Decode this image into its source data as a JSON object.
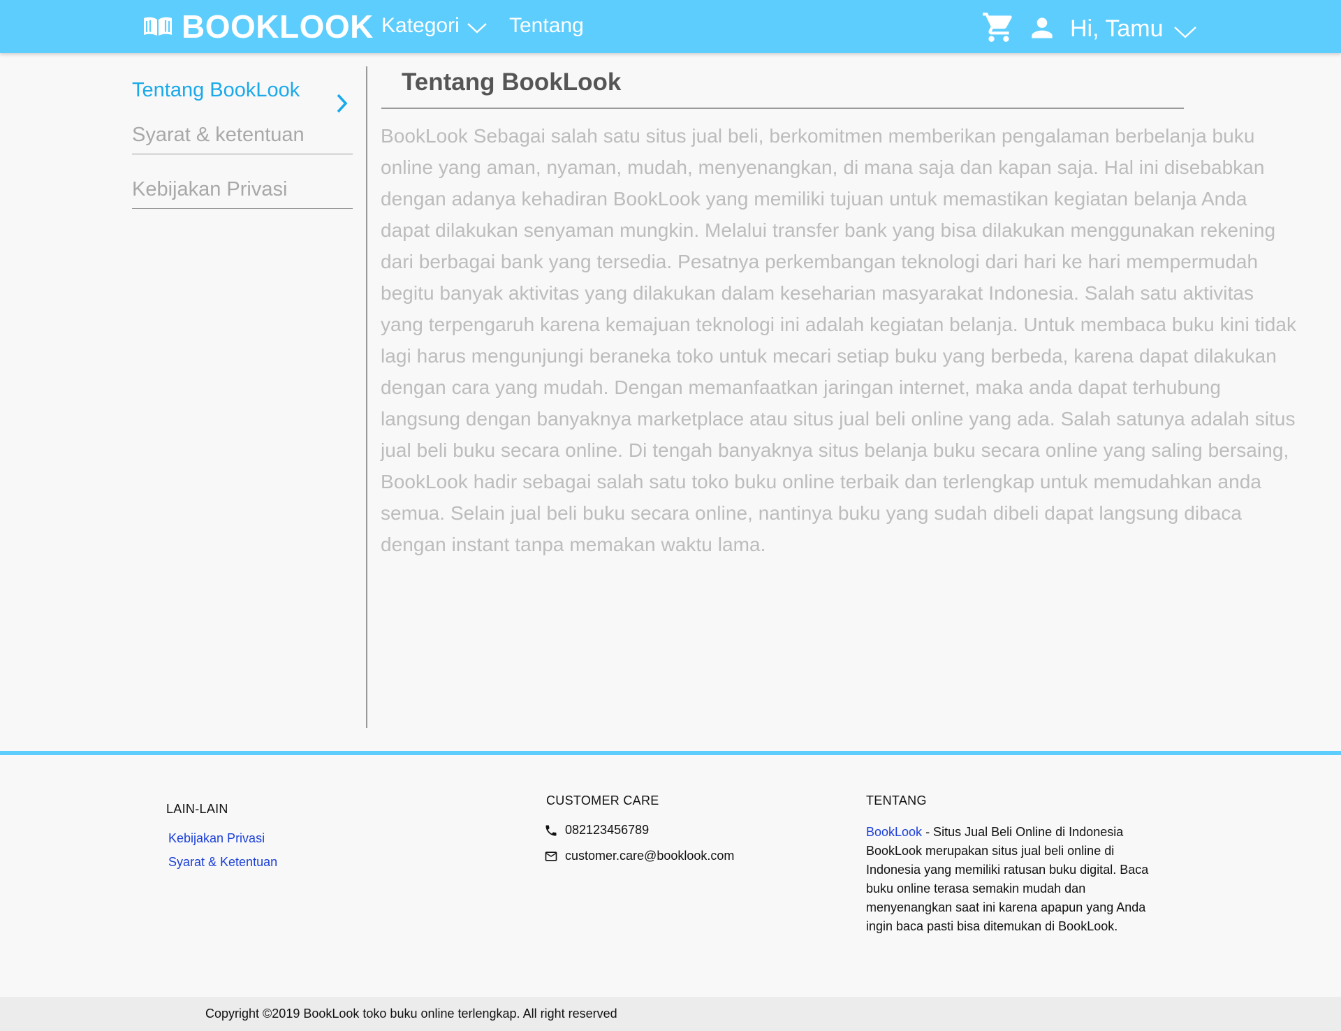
{
  "header": {
    "brand": "BOOKLOOK",
    "brand_icon": "open-book-icon",
    "nav": {
      "kategori": "Kategori",
      "tentang": "Tentang"
    },
    "cart_icon": "cart-icon",
    "user_icon": "user-icon",
    "greeting": "Hi, Tamu",
    "colors": {
      "bar": "#5ccdfd",
      "text": "#ffffff"
    }
  },
  "sidebar": {
    "items": [
      {
        "label": "Tentang BookLook",
        "active": true
      },
      {
        "label": "Syarat & ketentuan",
        "active": false
      },
      {
        "label": "Kebijakan Privasi",
        "active": false
      }
    ],
    "active_color": "#1ba9ea"
  },
  "main": {
    "title": "Tentang BookLook",
    "body": "BookLook Sebagai salah satu situs jual beli, berkomitmen memberikan pengalaman berbelanja buku online yang aman, nyaman, mudah, menyenangkan, di mana saja dan kapan saja. Hal ini disebabkan dengan adanya kehadiran BookLook yang memiliki tujuan untuk memastikan kegiatan belanja Anda dapat dilakukan senyaman mungkin. Melalui transfer bank yang bisa dilakukan menggunakan rekening dari berbagai bank yang tersedia. Pesatnya perkembangan teknologi dari hari ke hari mempermudah begitu banyak aktivitas yang dilakukan dalam keseharian masyarakat Indonesia. Salah satu aktivitas yang terpengaruh karena kemajuan teknologi ini adalah kegiatan belanja. Untuk membaca buku kini tidak lagi harus mengunjungi beraneka toko untuk mecari setiap buku yang berbeda, karena dapat dilakukan dengan cara yang mudah. Dengan memanfaatkan jaringan  internet, maka anda dapat terhubung langsung dengan banyaknya marketplace atau situs jual beli online yang ada. Salah satunya adalah situs jual beli buku secara online. Di tengah banyaknya situs belanja buku secara online yang saling bersaing, BookLook hadir sebagai salah satu toko buku online terbaik dan terlengkap untuk memudahkan anda semua. Selain jual beli buku secara online, nantinya buku yang sudah dibeli dapat langsung dibaca dengan instant tanpa memakan waktu lama."
  },
  "footer": {
    "lain_lain": {
      "heading": "LAIN-LAIN",
      "links": [
        "Kebijakan Privasi",
        "Syarat & Ketentuan"
      ]
    },
    "customer_care": {
      "heading": "CUSTOMER CARE",
      "phone": "082123456789",
      "phone_icon": "phone-icon",
      "email": "customer.care@booklook.com",
      "email_icon": "mail-icon"
    },
    "tentang": {
      "heading": "TENTANG",
      "brand_link": "BookLook",
      "tagline": " - Situs Jual Beli Online di Indonesia",
      "description": "BookLook merupakan situs jual beli online di Indonesia yang memiliki ratusan buku digital. Baca buku online terasa semakin mudah dan menyenangkan saat ini karena apapun yang Anda ingin baca pasti bisa ditemukan di BookLook."
    },
    "copyright": "Copyright ©2019 BookLook toko buku online terlengkap. All right reserved",
    "link_color": "#1b3fd8"
  }
}
